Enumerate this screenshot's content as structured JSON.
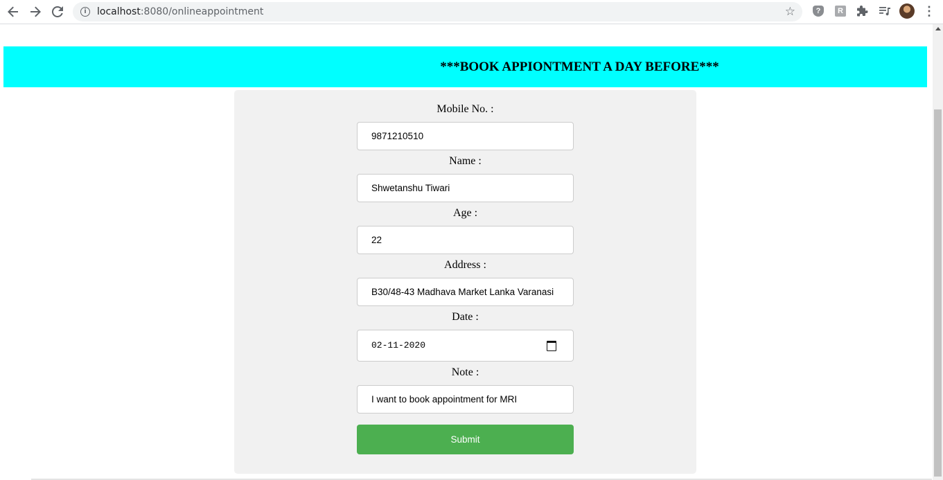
{
  "browser": {
    "url_host": "localhost",
    "url_path": ":8080/onlineappointment"
  },
  "banner": {
    "text": "***BOOK APPIONTMENT A DAY BEFORE***",
    "color": "#00ffff"
  },
  "form": {
    "mobile_label": "Mobile No. :",
    "mobile_value": "9871210510",
    "name_label": "Name :",
    "name_value": "Shwetanshu Tiwari",
    "age_label": "Age :",
    "age_value": "22",
    "address_label": "Address :",
    "address_value": "B30/48-43 Madhava Market Lanka Varanasi",
    "date_label": "Date :",
    "date_value": "02-11-2020",
    "note_label": "Note :",
    "note_value": "I want to book appointment for MRI",
    "submit_label": "Submit",
    "submit_color": "#4caf50"
  },
  "icons": [
    "back-arrow-icon",
    "forward-arrow-icon",
    "reload-icon",
    "info-icon",
    "star-icon",
    "help-shield-icon",
    "extension-r-icon",
    "puzzle-icon",
    "media-queue-icon",
    "avatar",
    "menu-dots-icon",
    "calendar-icon"
  ]
}
